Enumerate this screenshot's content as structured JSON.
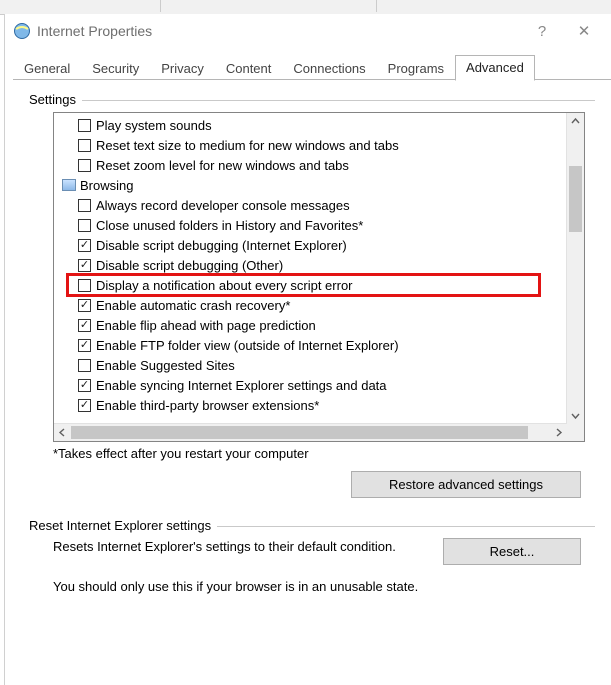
{
  "window": {
    "title": "Internet Properties",
    "help_symbol": "?",
    "close_symbol": "✕"
  },
  "tabs": [
    "General",
    "Security",
    "Privacy",
    "Content",
    "Connections",
    "Programs",
    "Advanced"
  ],
  "active_tab_index": 6,
  "settings_group_label": "Settings",
  "list": {
    "items": [
      {
        "type": "check",
        "checked": false,
        "label": "Play system sounds"
      },
      {
        "type": "check",
        "checked": false,
        "label": "Reset text size to medium for new windows and tabs"
      },
      {
        "type": "check",
        "checked": false,
        "label": "Reset zoom level for new windows and tabs"
      },
      {
        "type": "category",
        "label": "Browsing"
      },
      {
        "type": "check",
        "checked": false,
        "label": "Always record developer console messages"
      },
      {
        "type": "check",
        "checked": false,
        "label": "Close unused folders in History and Favorites*"
      },
      {
        "type": "check",
        "checked": true,
        "label": "Disable script debugging (Internet Explorer)"
      },
      {
        "type": "check",
        "checked": true,
        "label": "Disable script debugging (Other)"
      },
      {
        "type": "check",
        "checked": false,
        "label": "Display a notification about every script error",
        "highlight": true
      },
      {
        "type": "check",
        "checked": true,
        "label": "Enable automatic crash recovery*"
      },
      {
        "type": "check",
        "checked": true,
        "label": "Enable flip ahead with page prediction"
      },
      {
        "type": "check",
        "checked": true,
        "label": "Enable FTP folder view (outside of Internet Explorer)"
      },
      {
        "type": "check",
        "checked": false,
        "label": "Enable Suggested Sites"
      },
      {
        "type": "check",
        "checked": true,
        "label": "Enable syncing Internet Explorer settings and data"
      },
      {
        "type": "check",
        "checked": true,
        "label": "Enable third-party browser extensions*"
      }
    ]
  },
  "note_text": "*Takes effect after you restart your computer",
  "restore_btn": "Restore advanced settings",
  "reset_group_label": "Reset Internet Explorer settings",
  "reset_desc": "Resets Internet Explorer's settings to their default condition.",
  "reset_btn": "Reset...",
  "reset_warn": "You should only use this if your browser is in an unusable state."
}
